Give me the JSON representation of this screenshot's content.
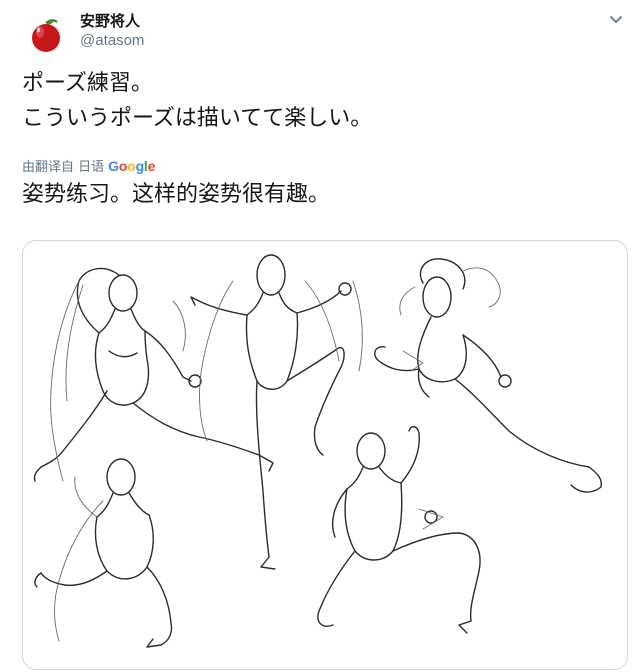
{
  "author": {
    "display_name": "安野将人",
    "handle": "@atasom",
    "avatar_icon": "apple-avatar-icon"
  },
  "tweet": {
    "line1": "ポーズ練習。",
    "line2": "こういうポーズは描いてて楽しい。"
  },
  "translation": {
    "label": "由翻译自 日语",
    "provider": "Google",
    "text": "姿势练习。这样的姿势很有趣。"
  },
  "media": {
    "alt": "pose sketch drawing"
  },
  "colors": {
    "text": "#14171a",
    "secondary": "#657786",
    "border": "#ccd6dd",
    "google_blue": "#4285F4",
    "google_red": "#EA4335",
    "google_yellow": "#FBBC05",
    "google_green": "#34A853"
  }
}
